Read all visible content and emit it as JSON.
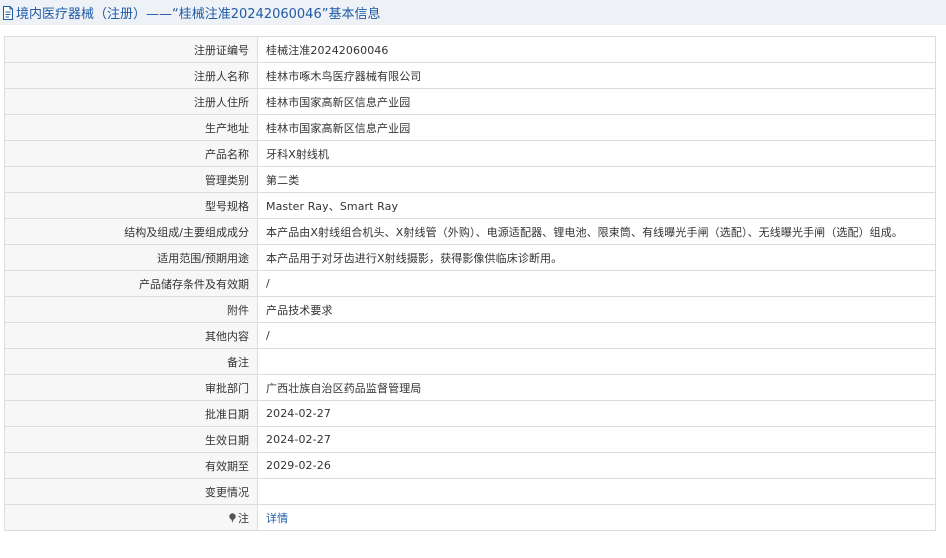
{
  "page": {
    "title": "境内医疗器械（注册）——“桂械注准20242060046”基本信息"
  },
  "rows": [
    {
      "label": "注册证编号",
      "value": "桂械注准20242060046"
    },
    {
      "label": "注册人名称",
      "value": "桂林市啄木鸟医疗器械有限公司"
    },
    {
      "label": "注册人住所",
      "value": "桂林市国家高新区信息产业园"
    },
    {
      "label": "生产地址",
      "value": "桂林市国家高新区信息产业园"
    },
    {
      "label": "产品名称",
      "value": "牙科X射线机"
    },
    {
      "label": "管理类别",
      "value": "第二类"
    },
    {
      "label": "型号规格",
      "value": "Master Ray、Smart Ray"
    },
    {
      "label": "结构及组成/主要组成成分",
      "value": "本产品由X射线组合机头、X射线管（外购）、电源适配器、锂电池、限束筒、有线曝光手闸（选配）、无线曝光手闸（选配）组成。"
    },
    {
      "label": "适用范围/预期用途",
      "value": "本产品用于对牙齿进行X射线摄影，获得影像供临床诊断用。"
    },
    {
      "label": "产品储存条件及有效期",
      "value": "/"
    },
    {
      "label": "附件",
      "value": "产品技术要求"
    },
    {
      "label": "其他内容",
      "value": "/"
    },
    {
      "label": "备注",
      "value": ""
    },
    {
      "label": "审批部门",
      "value": "广西壮族自治区药品监督管理局"
    },
    {
      "label": "批准日期",
      "value": "2024-02-27"
    },
    {
      "label": "生效日期",
      "value": "2024-02-27"
    },
    {
      "label": "有效期至",
      "value": "2029-02-26"
    },
    {
      "label": "变更情况",
      "value": ""
    }
  ],
  "note_row": {
    "label": "注",
    "link_text": "详情",
    "icon": "pin-icon"
  },
  "icons": {
    "title": "document-icon"
  },
  "colors": {
    "title_bar_bg": "#eef1f6",
    "title_text": "#1f5aa6",
    "label_bg": "#f7f7f7",
    "border": "#dcdcdc",
    "link": "#1f5aa6"
  }
}
